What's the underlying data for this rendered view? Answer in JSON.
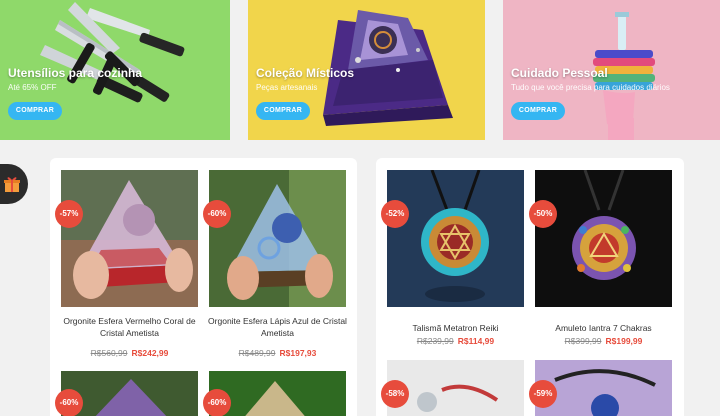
{
  "banners": [
    {
      "title": "Utensílios para cozinha",
      "subtitle": "Até 65% OFF",
      "button": "COMPRAR"
    },
    {
      "title": "Coleção Místicos",
      "subtitle": "Peças artesanais",
      "button": "COMPRAR"
    },
    {
      "title": "Cuidado Pessoal",
      "subtitle": "Tudo que você precisa para cuidados diários",
      "button": "COMPRAR"
    }
  ],
  "gift_icon": "gift-icon",
  "products_left": [
    {
      "discount": "-57%",
      "name": "Orgonite Esfera Vermelho Coral de Cristal Ametista",
      "old_price": "R$560,99",
      "price": "R$242,99"
    },
    {
      "discount": "-60%",
      "name": "Orgonite Esfera Lápis Azul de Cristal Ametista",
      "old_price": "R$489,99",
      "price": "R$197,93"
    },
    {
      "discount": "-60%"
    },
    {
      "discount": "-60%"
    }
  ],
  "products_right": [
    {
      "discount": "-52%",
      "name": "Talismã Metatron Reiki",
      "old_price": "R$239,99",
      "price": "R$114,99"
    },
    {
      "discount": "-50%",
      "name": "Amuleto Iantra 7 Chakras",
      "old_price": "R$399,99",
      "price": "R$199,99"
    },
    {
      "discount": "-58%"
    },
    {
      "discount": "-59%"
    }
  ],
  "colors": {
    "accent_button": "#35b6f2",
    "discount": "#e74c3c",
    "price": "#e74c3c"
  }
}
